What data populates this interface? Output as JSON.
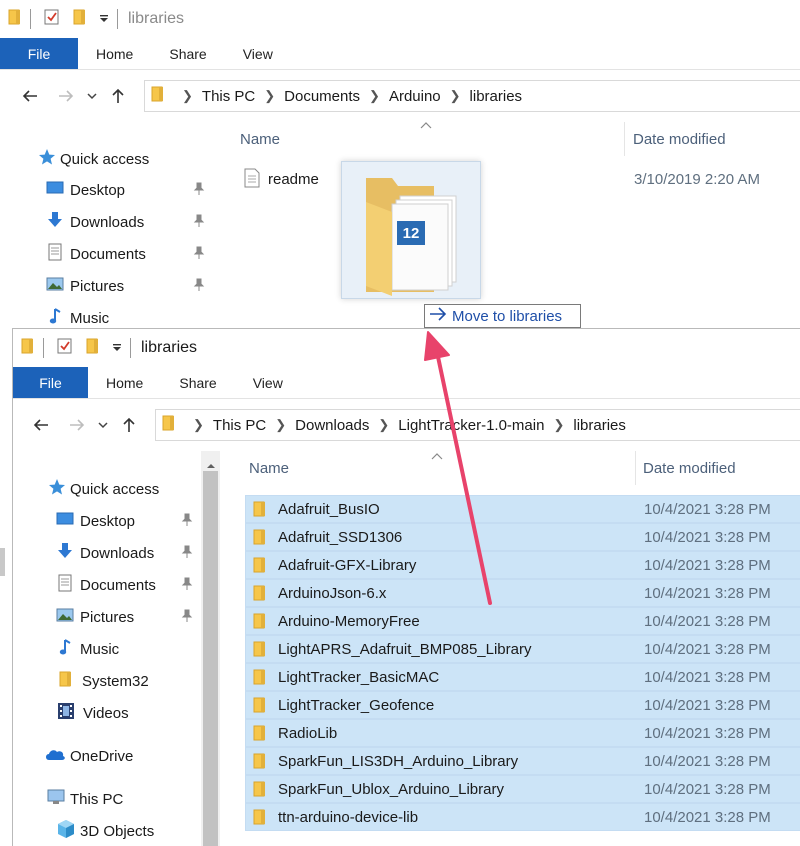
{
  "top_window": {
    "title": "libraries",
    "ribbon_tabs": [
      "File",
      "Home",
      "Share",
      "View"
    ],
    "breadcrumb": [
      "This PC",
      "Documents",
      "Arduino",
      "libraries"
    ],
    "nav": [
      {
        "label": "Quick access",
        "icon": "star-icon"
      },
      {
        "label": "Desktop",
        "icon": "desktop-icon",
        "pinned": true
      },
      {
        "label": "Downloads",
        "icon": "download-icon",
        "pinned": true
      },
      {
        "label": "Documents",
        "icon": "documents-icon",
        "pinned": true
      },
      {
        "label": "Pictures",
        "icon": "pictures-icon",
        "pinned": true
      },
      {
        "label": "Music",
        "icon": "music-icon"
      }
    ],
    "columns": {
      "name": "Name",
      "date": "Date modified"
    },
    "files": [
      {
        "name": "readme",
        "date": "3/10/2019 2:20 AM",
        "icon": "text-file-icon"
      }
    ]
  },
  "drag": {
    "count": "12",
    "tooltip": "Move to libraries"
  },
  "bottom_window": {
    "title": "libraries",
    "ribbon_tabs": [
      "File",
      "Home",
      "Share",
      "View"
    ],
    "breadcrumb": [
      "This PC",
      "Downloads",
      "LightTracker-1.0-main",
      "libraries"
    ],
    "nav": [
      {
        "label": "Quick access",
        "icon": "star-icon"
      },
      {
        "label": "Desktop",
        "icon": "desktop-icon",
        "pinned": true
      },
      {
        "label": "Downloads",
        "icon": "download-icon",
        "pinned": true
      },
      {
        "label": "Documents",
        "icon": "documents-icon",
        "pinned": true
      },
      {
        "label": "Pictures",
        "icon": "pictures-icon",
        "pinned": true
      },
      {
        "label": "Music",
        "icon": "music-icon"
      },
      {
        "label": "System32",
        "icon": "folder-icon"
      },
      {
        "label": "Videos",
        "icon": "videos-icon"
      },
      {
        "label": "OneDrive",
        "icon": "cloud-icon"
      },
      {
        "label": "This PC",
        "icon": "computer-icon"
      },
      {
        "label": "3D Objects",
        "icon": "cube-icon"
      }
    ],
    "columns": {
      "name": "Name",
      "date": "Date modified"
    },
    "folders": [
      {
        "name": "Adafruit_BusIO",
        "date": "10/4/2021 3:28 PM"
      },
      {
        "name": "Adafruit_SSD1306",
        "date": "10/4/2021 3:28 PM"
      },
      {
        "name": "Adafruit-GFX-Library",
        "date": "10/4/2021 3:28 PM"
      },
      {
        "name": "ArduinoJson-6.x",
        "date": "10/4/2021 3:28 PM"
      },
      {
        "name": "Arduino-MemoryFree",
        "date": "10/4/2021 3:28 PM"
      },
      {
        "name": "LightAPRS_Adafruit_BMP085_Library",
        "date": "10/4/2021 3:28 PM"
      },
      {
        "name": "LightTracker_BasicMAC",
        "date": "10/4/2021 3:28 PM"
      },
      {
        "name": "LightTracker_Geofence",
        "date": "10/4/2021 3:28 PM"
      },
      {
        "name": "RadioLib",
        "date": "10/4/2021 3:28 PM"
      },
      {
        "name": "SparkFun_LIS3DH_Arduino_Library",
        "date": "10/4/2021 3:28 PM"
      },
      {
        "name": "SparkFun_Ublox_Arduino_Library",
        "date": "10/4/2021 3:28 PM"
      },
      {
        "name": "ttn-arduino-device-lib",
        "date": "10/4/2021 3:28 PM"
      }
    ]
  },
  "colors": {
    "file_tab": "#1c62b9",
    "selection": "#cce4f7",
    "folder": "#f6c64a",
    "annotation_arrow": "#e8436b"
  }
}
